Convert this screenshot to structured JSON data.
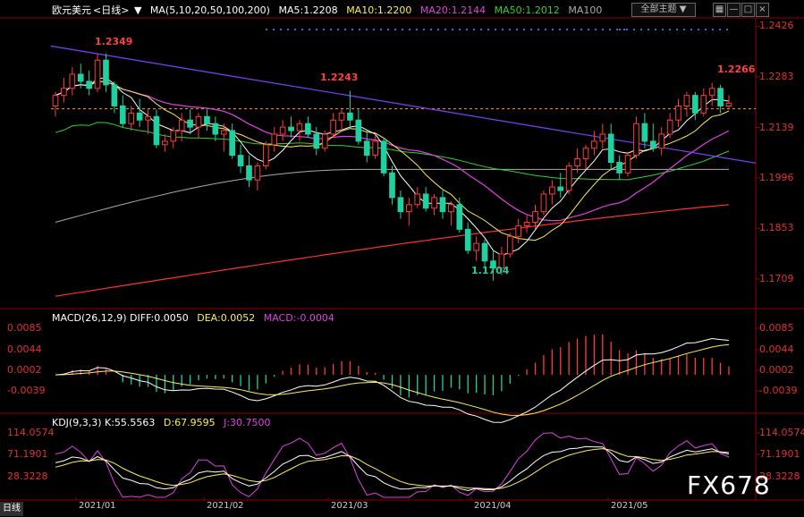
{
  "header": {
    "symbol": "欧元美元",
    "period": "<日线>",
    "ma_spec": "MA(5,10,20,50,100,200)",
    "ma5": "MA5:1.2208",
    "ma10": "MA10:1.2200",
    "ma20": "MA20:1.2144",
    "ma50": "MA50:1.2012",
    "ma100": "MA100",
    "all_indicators_btn": "全部主题"
  },
  "colors": {
    "up": "#ff3b3b",
    "down": "#20d0a0",
    "ma5": "#ffffff",
    "ma10": "#ffee55",
    "ma20": "#e040e0",
    "ma50": "#30d030",
    "ma100": "#aaaaaa",
    "ma200": "#ff3030",
    "trendline": "#8040ff",
    "ref_line": "#ff9a30"
  },
  "icons": [
    "chevron-down-icon",
    "grid-icon",
    "minus-icon",
    "maximize-icon",
    "close-icon"
  ],
  "price_axis": [
    "1.2426",
    "1.2283",
    "1.2139",
    "1.1996",
    "1.1853",
    "1.1709"
  ],
  "macd_axis": [
    "0.0085",
    "0.0044",
    "0.0002",
    "-0.0039"
  ],
  "kdj_axis": [
    "114.0574",
    "71.1901",
    "28.3228"
  ],
  "x_labels": [
    "2021/01",
    "2021/02",
    "2021/03",
    "2021/04",
    "2021/05"
  ],
  "annotations": {
    "high1": "1.2349",
    "high2": "1.2243",
    "low": "1.1704",
    "recent_high": "1.2266"
  },
  "macd_header": {
    "spec": "MACD(26,12,9)",
    "diff": "DIFF:0.0050",
    "dea": "DEA:0.0052",
    "macd": "MACD:-0.0004"
  },
  "kdj_header": {
    "spec": "KDJ(9,3,3)",
    "k": "K:55.5563",
    "d": "D:67.9595",
    "j": "J:30.7500"
  },
  "brand": "FX678",
  "day_badge": "日线",
  "chart_data": {
    "type": "candlestick",
    "ylim": [
      1.163,
      1.245
    ],
    "ref_level": 1.2192,
    "candles": [
      [
        1.22,
        1.224,
        1.217,
        1.223
      ],
      [
        1.223,
        1.228,
        1.221,
        1.225
      ],
      [
        1.225,
        1.231,
        1.223,
        1.229
      ],
      [
        1.229,
        1.232,
        1.225,
        1.227
      ],
      [
        1.227,
        1.23,
        1.223,
        1.225
      ],
      [
        1.225,
        1.2349,
        1.224,
        1.233
      ],
      [
        1.233,
        1.2349,
        1.224,
        1.226
      ],
      [
        1.226,
        1.227,
        1.218,
        1.22
      ],
      [
        1.22,
        1.223,
        1.214,
        1.215
      ],
      [
        1.215,
        1.22,
        1.213,
        1.218
      ],
      [
        1.218,
        1.222,
        1.214,
        1.216
      ],
      [
        1.216,
        1.219,
        1.212,
        1.217
      ],
      [
        1.217,
        1.219,
        1.208,
        1.209
      ],
      [
        1.209,
        1.212,
        1.207,
        1.21
      ],
      [
        1.21,
        1.214,
        1.208,
        1.213
      ],
      [
        1.213,
        1.218,
        1.21,
        1.216
      ],
      [
        1.216,
        1.219,
        1.212,
        1.214
      ],
      [
        1.214,
        1.218,
        1.211,
        1.217
      ],
      [
        1.217,
        1.219,
        1.213,
        1.215
      ],
      [
        1.215,
        1.217,
        1.21,
        1.212
      ],
      [
        1.212,
        1.215,
        1.207,
        1.213
      ],
      [
        1.213,
        1.215,
        1.205,
        1.206
      ],
      [
        1.206,
        1.209,
        1.201,
        1.203
      ],
      [
        1.203,
        1.206,
        1.197,
        1.199
      ],
      [
        1.199,
        1.204,
        1.196,
        1.203
      ],
      [
        1.203,
        1.21,
        1.202,
        1.209
      ],
      [
        1.209,
        1.214,
        1.207,
        1.212
      ],
      [
        1.212,
        1.216,
        1.21,
        1.214
      ],
      [
        1.214,
        1.217,
        1.211,
        1.213
      ],
      [
        1.213,
        1.216,
        1.21,
        1.215
      ],
      [
        1.215,
        1.217,
        1.211,
        1.212
      ],
      [
        1.212,
        1.214,
        1.206,
        1.208
      ],
      [
        1.208,
        1.213,
        1.207,
        1.212
      ],
      [
        1.212,
        1.218,
        1.211,
        1.216
      ],
      [
        1.216,
        1.219,
        1.213,
        1.218
      ],
      [
        1.218,
        1.2243,
        1.214,
        1.216
      ],
      [
        1.216,
        1.219,
        1.209,
        1.21
      ],
      [
        1.21,
        1.213,
        1.204,
        1.206
      ],
      [
        1.206,
        1.212,
        1.205,
        1.21
      ],
      [
        1.21,
        1.211,
        1.2,
        1.201
      ],
      [
        1.201,
        1.203,
        1.192,
        1.194
      ],
      [
        1.194,
        1.196,
        1.188,
        1.19
      ],
      [
        1.19,
        1.194,
        1.186,
        1.192
      ],
      [
        1.192,
        1.197,
        1.191,
        1.195
      ],
      [
        1.195,
        1.197,
        1.19,
        1.191
      ],
      [
        1.191,
        1.195,
        1.189,
        1.194
      ],
      [
        1.194,
        1.196,
        1.188,
        1.19
      ],
      [
        1.19,
        1.193,
        1.186,
        1.192
      ],
      [
        1.192,
        1.194,
        1.184,
        1.185
      ],
      [
        1.185,
        1.187,
        1.178,
        1.179
      ],
      [
        1.179,
        1.183,
        1.176,
        1.181
      ],
      [
        1.181,
        1.182,
        1.174,
        1.176
      ],
      [
        1.176,
        1.179,
        1.1704,
        1.174
      ],
      [
        1.174,
        1.18,
        1.172,
        1.178
      ],
      [
        1.178,
        1.184,
        1.177,
        1.183
      ],
      [
        1.183,
        1.188,
        1.181,
        1.186
      ],
      [
        1.186,
        1.189,
        1.184,
        1.187
      ],
      [
        1.187,
        1.192,
        1.185,
        1.19
      ],
      [
        1.19,
        1.196,
        1.189,
        1.195
      ],
      [
        1.195,
        1.199,
        1.192,
        1.197
      ],
      [
        1.197,
        1.201,
        1.194,
        1.196
      ],
      [
        1.196,
        1.204,
        1.195,
        1.203
      ],
      [
        1.203,
        1.208,
        1.201,
        1.205
      ],
      [
        1.205,
        1.209,
        1.202,
        1.208
      ],
      [
        1.208,
        1.213,
        1.206,
        1.21
      ],
      [
        1.21,
        1.215,
        1.208,
        1.212
      ],
      [
        1.212,
        1.215,
        1.202,
        1.204
      ],
      [
        1.204,
        1.206,
        1.199,
        1.201
      ],
      [
        1.201,
        1.207,
        1.2,
        1.206
      ],
      [
        1.206,
        1.217,
        1.205,
        1.215
      ],
      [
        1.215,
        1.218,
        1.208,
        1.21
      ],
      [
        1.21,
        1.215,
        1.207,
        1.208
      ],
      [
        1.208,
        1.214,
        1.206,
        1.212
      ],
      [
        1.212,
        1.218,
        1.211,
        1.216
      ],
      [
        1.216,
        1.222,
        1.214,
        1.22
      ],
      [
        1.22,
        1.224,
        1.217,
        1.223
      ],
      [
        1.223,
        1.224,
        1.216,
        1.218
      ],
      [
        1.218,
        1.225,
        1.217,
        1.223
      ],
      [
        1.223,
        1.2266,
        1.22,
        1.225
      ],
      [
        1.225,
        1.226,
        1.218,
        1.22
      ],
      [
        1.22,
        1.223,
        1.219,
        1.2208
      ]
    ]
  }
}
